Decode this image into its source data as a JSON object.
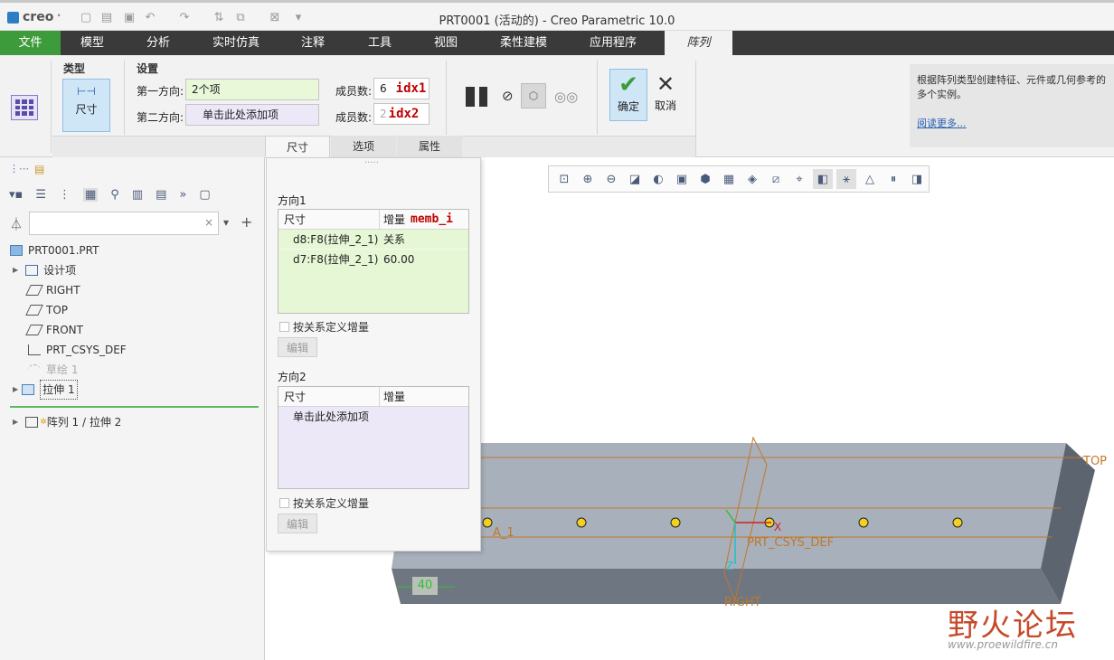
{
  "titlebar": {
    "logo": "creo",
    "title": "PRT0001 (活动的) - Creo Parametric 10.0",
    "quick_access_icons": [
      "new-icon",
      "open-icon",
      "save-icon",
      "undo-icon",
      "redo-icon",
      "regenerate-icon",
      "windows-icon",
      "close-window-icon",
      "customize-icon"
    ]
  },
  "menu": {
    "tabs": [
      "文件",
      "模型",
      "分析",
      "实时仿真",
      "注释",
      "工具",
      "视图",
      "柔性建模",
      "应用程序",
      "阵列"
    ]
  },
  "ribbon": {
    "type_group": {
      "label": "类型",
      "button": "尺寸"
    },
    "settings_group": {
      "label": "设置",
      "dir1_label": "第一方向:",
      "dir1_value": "2个项",
      "dir2_label": "第二方向:",
      "dir2_value": "单击此处添加项",
      "members1_label": "成员数:",
      "members1_value": "6",
      "members1_code": "idx1",
      "members2_label": "成员数:",
      "members2_value": "2",
      "members2_code": "idx2"
    },
    "ok_label": "确定",
    "cancel_label": "取消",
    "subtabs": [
      "尺寸",
      "选项",
      "属性"
    ],
    "help_text": "根据阵列类型创建特征、元件或几何参考的多个实例。",
    "help_link": "阅读更多..."
  },
  "model_tree": {
    "search_placeholder": "",
    "items": [
      {
        "label": "PRT0001.PRT"
      },
      {
        "label": "设计项"
      },
      {
        "label": "RIGHT"
      },
      {
        "label": "TOP"
      },
      {
        "label": "FRONT"
      },
      {
        "label": "PRT_CSYS_DEF"
      },
      {
        "label": "草绘 1"
      },
      {
        "label": "拉伸 1"
      },
      {
        "label": "阵列 1 / 拉伸 2"
      }
    ]
  },
  "dimensions_panel": {
    "dir1_title": "方向1",
    "col_dim": "尺寸",
    "col_inc": "增量",
    "col_inc_code": "memb_i",
    "rows": [
      {
        "dim": "d8:F8(拉伸_2_1)",
        "inc": "关系"
      },
      {
        "dim": "d7:F8(拉伸_2_1)",
        "inc": "60.00"
      }
    ],
    "relation_checkbox": "按关系定义增量",
    "edit_button": "编辑",
    "dir2_title": "方向2",
    "dir2_placeholder": "单击此处添加项"
  },
  "viewport": {
    "labels": {
      "top": "TOP",
      "right": "RIGHT",
      "csys": "PRT_CSYS_DEF",
      "axis": "A_1",
      "dim": "40",
      "x": "X",
      "z": "Z"
    },
    "watermark_cn": "野火论坛",
    "watermark_url": "www.proewildfire.cn"
  },
  "colors": {
    "file_tab": "#3e9b3b",
    "menubar": "#3a3a3a",
    "accent": "#2d7fc1",
    "code_red": "#c00000"
  }
}
